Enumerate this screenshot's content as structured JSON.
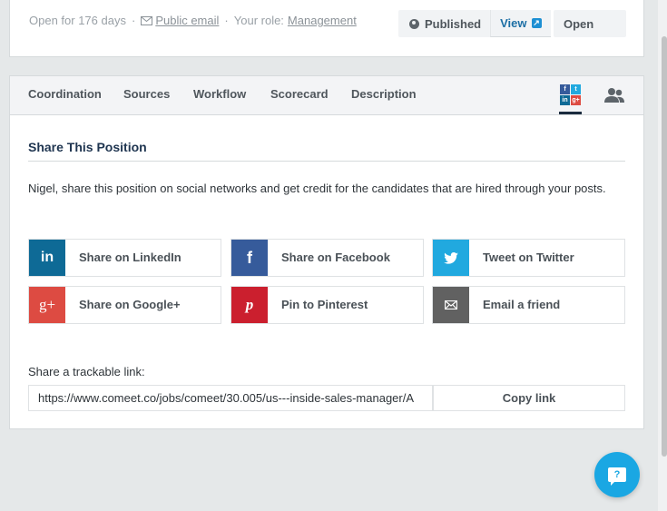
{
  "header": {
    "open_for": "Open for 176 days",
    "separator": "·",
    "public_email": "Public email",
    "role_label": "Your role:",
    "role_value": "Management",
    "published_label": "Published",
    "view_label": "View",
    "open_label": "Open"
  },
  "tabs": [
    {
      "label": "Coordination"
    },
    {
      "label": "Sources"
    },
    {
      "label": "Workflow"
    },
    {
      "label": "Scorecard"
    },
    {
      "label": "Description"
    }
  ],
  "social_tab": {
    "active": true,
    "icons": [
      "f",
      "t",
      "in",
      "g+"
    ]
  },
  "share": {
    "title": "Share This Position",
    "intro": "Nigel, share this position on social networks and get credit for the candidates that are hired through your posts.",
    "buttons": [
      {
        "label": "Share on LinkedIn",
        "icon": "linkedin-icon",
        "glyph": "in",
        "color": "#0e6a96"
      },
      {
        "label": "Share on Facebook",
        "icon": "facebook-icon",
        "glyph": "f",
        "color": "#365b9b"
      },
      {
        "label": "Tweet on Twitter",
        "icon": "twitter-icon",
        "glyph": "🐦",
        "color": "#21a9df"
      },
      {
        "label": "Share on Google+",
        "icon": "google-plus-icon",
        "glyph": "g+",
        "color": "#dd4b42"
      },
      {
        "label": "Pin to Pinterest",
        "icon": "pinterest-icon",
        "glyph": "p",
        "color": "#cb1f2e"
      },
      {
        "label": "Email a friend",
        "icon": "email-icon",
        "glyph": "✉",
        "color": "#616161"
      }
    ],
    "link_label": "Share a trackable link:",
    "link_value": "https://www.comeet.co/jobs/comeet/30.005/us---inside-sales-manager/A",
    "copy_label": "Copy link"
  },
  "help": {
    "glyph": "?"
  },
  "colors": {
    "accent_blue": "#1d6fa5",
    "help_blue": "#1aa7e3",
    "title_navy": "#1f3550"
  }
}
